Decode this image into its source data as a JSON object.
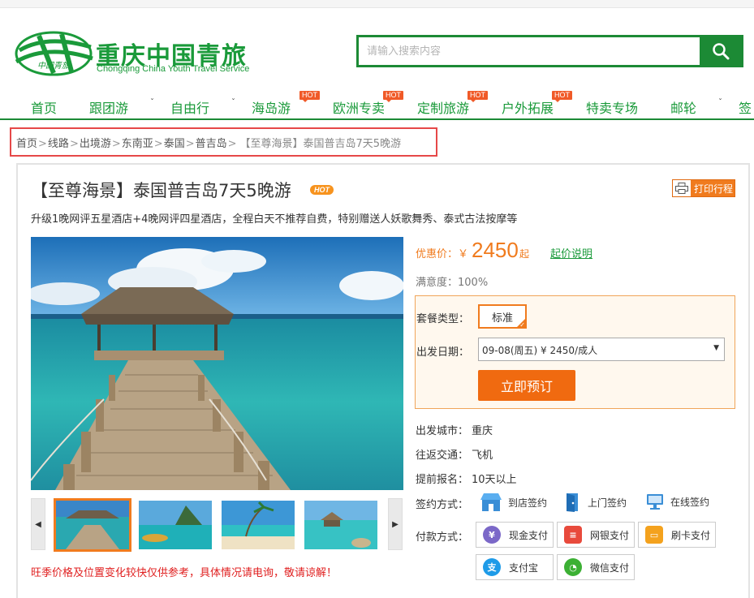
{
  "logo": {
    "cn": "重庆中国青旅",
    "en": "Chongqing China Youth Travel Service",
    "mark_text": "中国青旅"
  },
  "search": {
    "placeholder": "请输入搜索内容"
  },
  "nav": [
    {
      "label": "首页",
      "caret": false,
      "hot": false
    },
    {
      "label": "跟团游",
      "caret": true,
      "hot": false
    },
    {
      "label": "自由行",
      "caret": true,
      "hot": false
    },
    {
      "label": "海岛游",
      "caret": false,
      "hot": true
    },
    {
      "label": "欧洲专卖",
      "caret": false,
      "hot": true
    },
    {
      "label": "定制旅游",
      "caret": false,
      "hot": true
    },
    {
      "label": "户外拓展",
      "caret": false,
      "hot": true
    },
    {
      "label": "特卖专场",
      "caret": false,
      "hot": false
    },
    {
      "label": "邮轮",
      "caret": true,
      "hot": false
    },
    {
      "label": "签",
      "caret": false,
      "hot": false
    }
  ],
  "hot_label": "HOT",
  "breadcrumb": {
    "items": [
      "首页",
      "线路",
      "出境游",
      "东南亚",
      "泰国",
      "普吉岛"
    ],
    "separator": ">",
    "current": "【至尊海景】泰国普吉岛7天5晚游"
  },
  "product": {
    "title": "【至尊海景】泰国普吉岛7天5晚游",
    "title_badge": "HOT",
    "print_label": "打印行程",
    "subtitle": "升级1晚网评五星酒店+4晚网评四星酒店，全程白天不推荐自费，特别赠送人妖歌舞秀、泰式古法按摩等",
    "notice": "旺季价格及位置变化较快仅供参考，具体情况请电询，敬请谅解！"
  },
  "price": {
    "label": "优惠价：￥",
    "value": "2450",
    "unit": "起",
    "explain": "起价说明"
  },
  "satisfaction": "满意度：100%",
  "booking": {
    "package_label": "套餐类型：",
    "package_value": "标准",
    "date_label": "出发日期：",
    "date_value": "09-08(周五) ¥ 2450/成人",
    "book_button": "立即预订"
  },
  "info": {
    "city_label": "出发城市：",
    "city_value": "重庆",
    "transport_label": "往返交通：",
    "transport_value": "飞机",
    "advance_label": "提前报名：",
    "advance_value": "10天以上",
    "sign_label": "签约方式：",
    "sign_options": [
      "到店签约",
      "上门签约",
      "在线签约"
    ],
    "pay_label": "付款方式：",
    "pay_options": [
      "现金支付",
      "网银支付",
      "刷卡支付",
      "支付宝",
      "微信支付"
    ]
  },
  "colors": {
    "brand_green": "#1c8a35",
    "accent_orange": "#f07b1e",
    "notice_red": "#e02020"
  }
}
